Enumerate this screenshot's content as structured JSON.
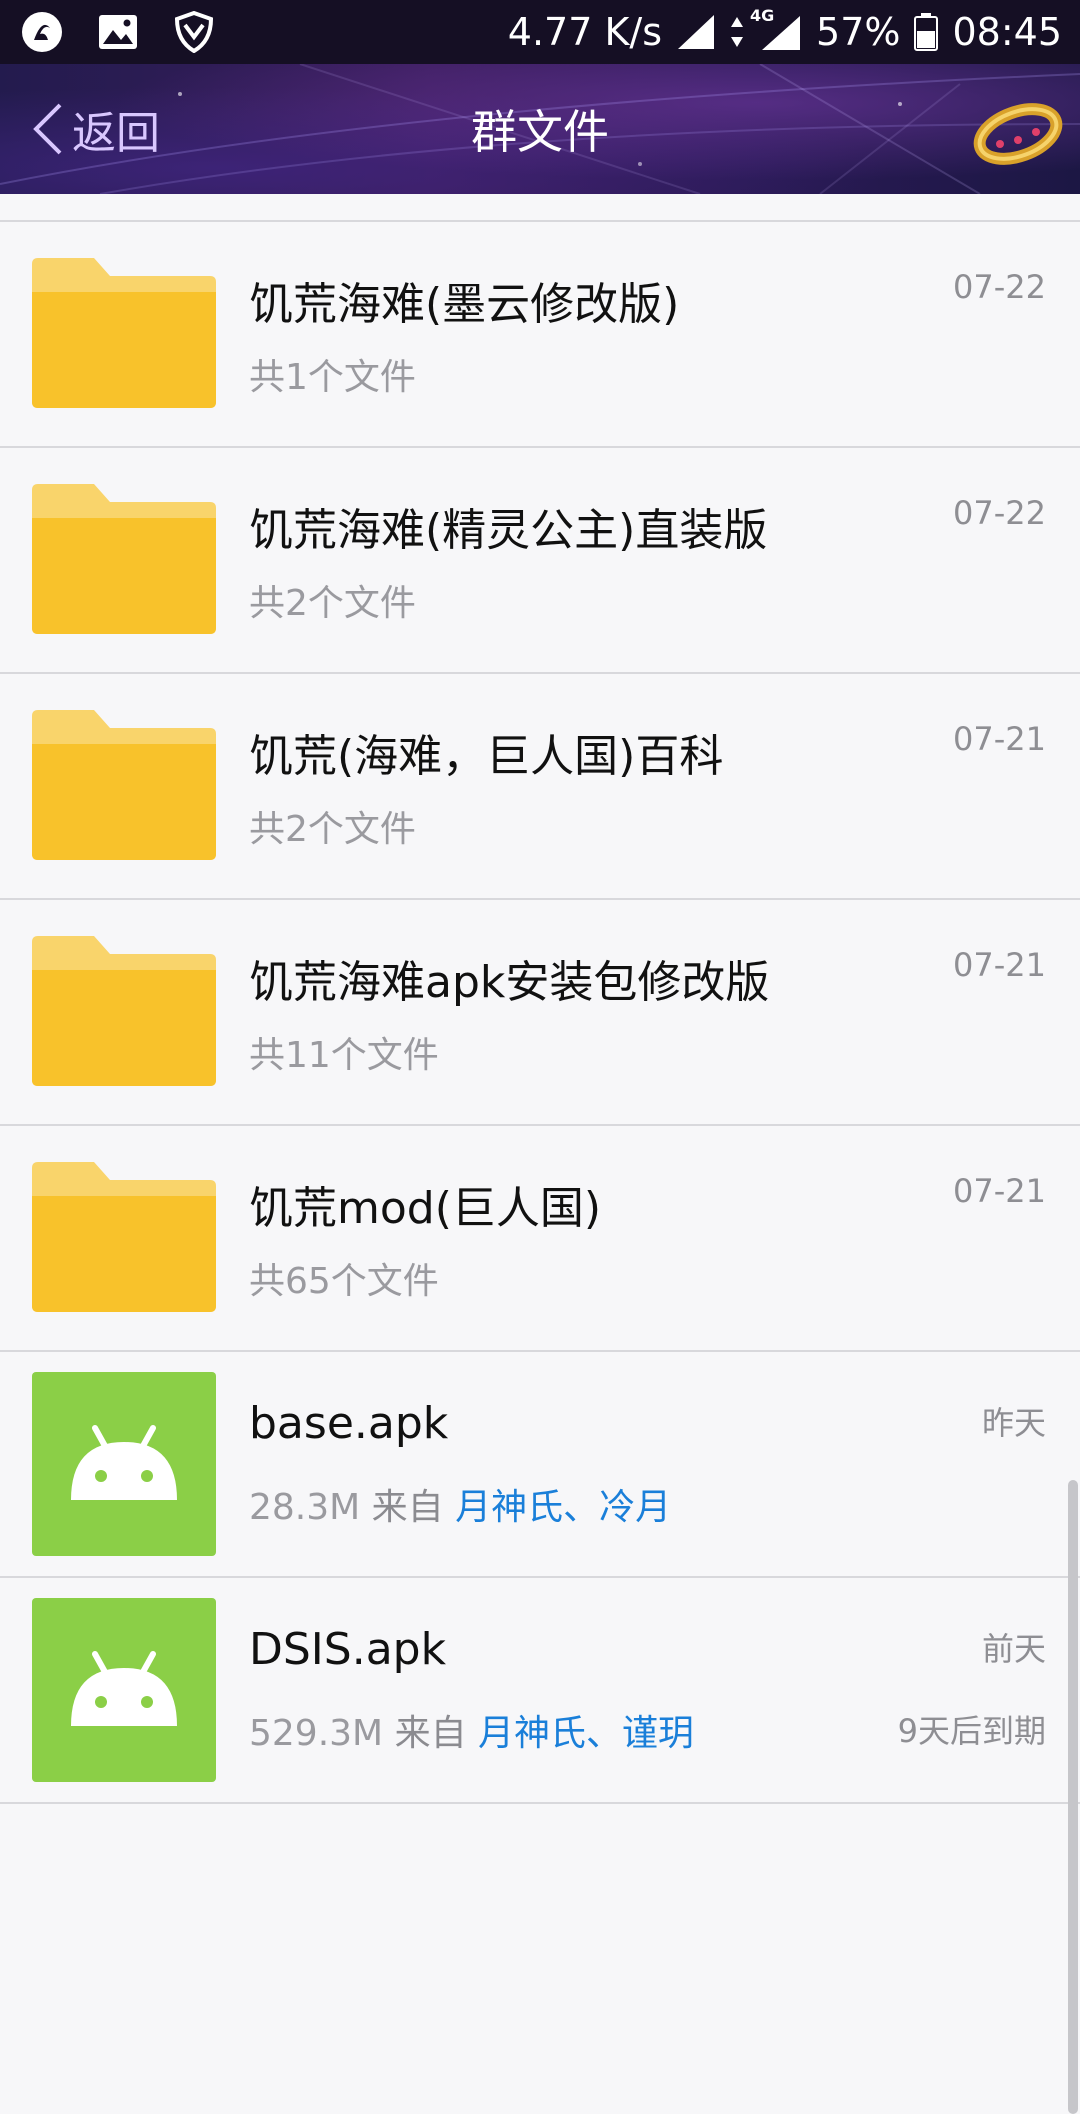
{
  "status_bar": {
    "speed": "4.77 K/s",
    "network": "4G",
    "battery": "57%",
    "time": "08:45"
  },
  "header": {
    "back_label": "返回",
    "title": "群文件"
  },
  "files": [
    {
      "type": "folder",
      "name": "饥荒海难(墨云修改版)",
      "sub": "共1个文件",
      "date": "07-22"
    },
    {
      "type": "folder",
      "name": "饥荒海难(精灵公主)直装版",
      "sub": "共2个文件",
      "date": "07-22"
    },
    {
      "type": "folder",
      "name": "饥荒(海难，巨人国)百科",
      "sub": "共2个文件",
      "date": "07-21"
    },
    {
      "type": "folder",
      "name": "饥荒海难apk安装包修改版",
      "sub": "共11个文件",
      "date": "07-21"
    },
    {
      "type": "folder",
      "name": "饥荒mod(巨人国)",
      "sub": "共65个文件",
      "date": "07-21"
    },
    {
      "type": "apk",
      "name": "base.apk",
      "size": "28.3M",
      "from_label": "来自",
      "senders": "月神氏、冷月",
      "date": "昨天"
    },
    {
      "type": "apk",
      "name": "DSIS.apk",
      "size": "529.3M",
      "from_label": "来自",
      "senders": "月神氏、谨玥",
      "date": "前天",
      "expiry": "9天后到期"
    }
  ],
  "colors": {
    "folder": "#f8c22b",
    "apk_bg": "#8bcf47",
    "link": "#1a7fd9"
  }
}
